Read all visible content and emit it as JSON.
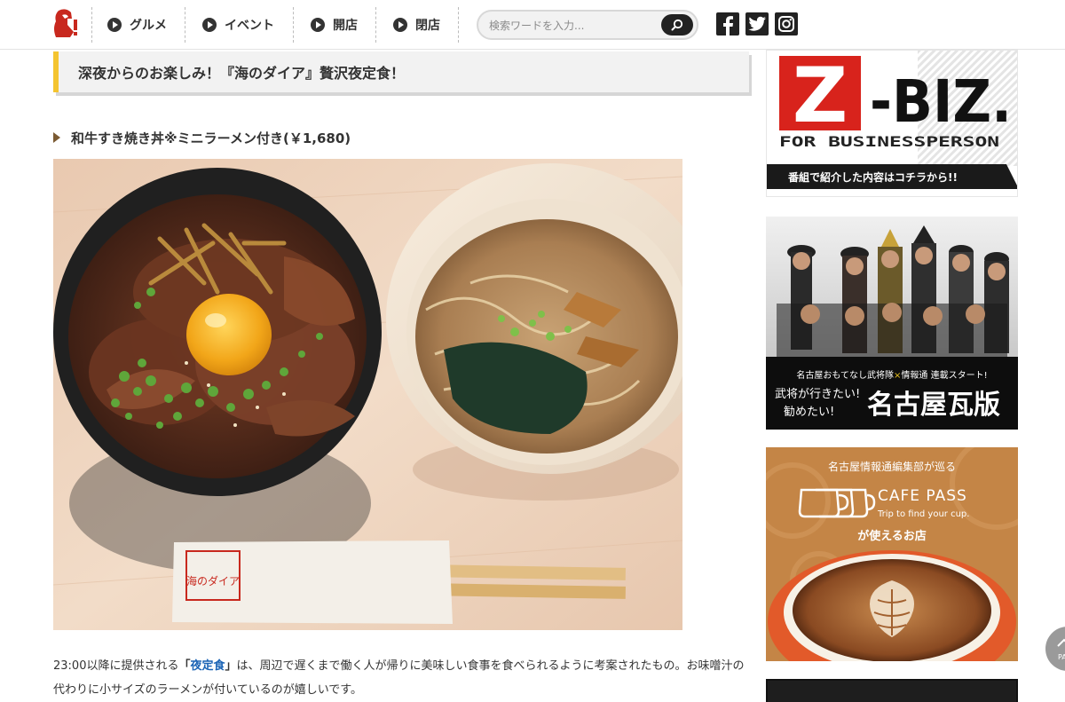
{
  "header": {
    "nav": [
      {
        "label": "グルメ"
      },
      {
        "label": "イベント"
      },
      {
        "label": "開店"
      },
      {
        "label": "閉店"
      }
    ],
    "search": {
      "placeholder": "検索ワードを入力..."
    }
  },
  "article": {
    "title": "深夜からのお楽しみ！『海のダイア』贅沢夜定食！",
    "subtitle": "和牛すき焼き丼※ミニラーメン付き(￥1,680)",
    "body": {
      "pre": "23:00以降に提供される",
      "highlight_open": "「",
      "highlight": "夜定食",
      "highlight_close": "」",
      "post": "は、周辺で遅くまで働く人が帰りに美味しい食事を食べられるように考案されたもの。お味噌汁の代わりに小サイズのラーメンが付いているのが嬉しいです。"
    },
    "chopstick_text": "海のダイア"
  },
  "sidebar": {
    "zbiz": {
      "logo_z": "Z",
      "logo_rest": "-BIZ.",
      "tagline": "FOR BUSINESSPERSON",
      "banner": "番組で紹介した内容はコチラから!!"
    },
    "nagoya": {
      "small": "名古屋おもてなし武将隊",
      "x_mark": "×",
      "small_tail": "情報通 連載スタート!",
      "line1": "武将が行きたい!",
      "line2": "勧めたい!",
      "big": "名古屋瓦版"
    },
    "cafepass": {
      "top": "名古屋情報通編集部が巡る",
      "title": "CAFE PASS",
      "sub": "Trip to find your cup.",
      "bottom": "が使えるお店"
    }
  },
  "scroll_top": {
    "label": "PAGE"
  },
  "colors": {
    "accent_yellow": "#f4c430",
    "link_blue": "#1a63b5",
    "zbiz_red": "#d8231c",
    "logo_red": "#c8281e"
  },
  "icons": [
    "logo-icon",
    "nav-arrow-icon",
    "search-icon",
    "facebook-icon",
    "twitter-icon",
    "instagram-icon",
    "subtitle-triangle-icon"
  ]
}
